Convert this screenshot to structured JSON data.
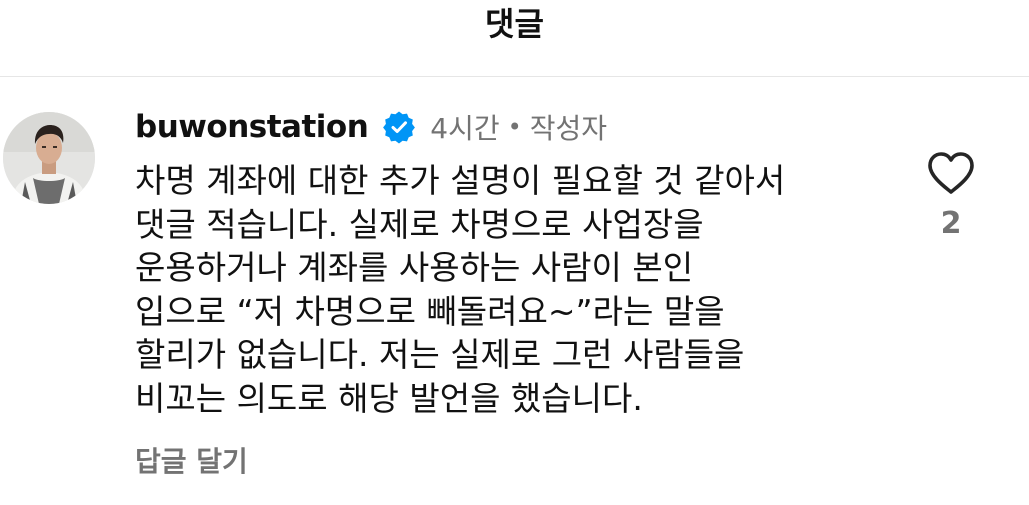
{
  "header": {
    "title": "댓글"
  },
  "comment": {
    "username": "buwonstation",
    "verified": true,
    "time": "4시간",
    "separator": "•",
    "author_tag": "작성자",
    "text": "차명 계좌에 대한 추가 설명이 필요할 것 같아서\n댓글 적습니다. 실제로 차명으로 사업장을\n운용하거나 계좌를 사용하는 사람이 본인\n입으로 “저 차명으로 빼돌려요~”라는 말을\n할리가 없습니다. 저는 실제로 그런 사람들을\n비꼬는 의도로 해당 발언을 했습니다.",
    "reply_label": "답글 달기",
    "like_count": "2",
    "icons": {
      "avatar": "avatar-photo",
      "verified": "verified-badge-icon",
      "like": "heart-outline-icon"
    }
  },
  "colors": {
    "verified_blue": "#0095F6",
    "meta_gray": "#737373",
    "divider": "#E6E6E6"
  }
}
